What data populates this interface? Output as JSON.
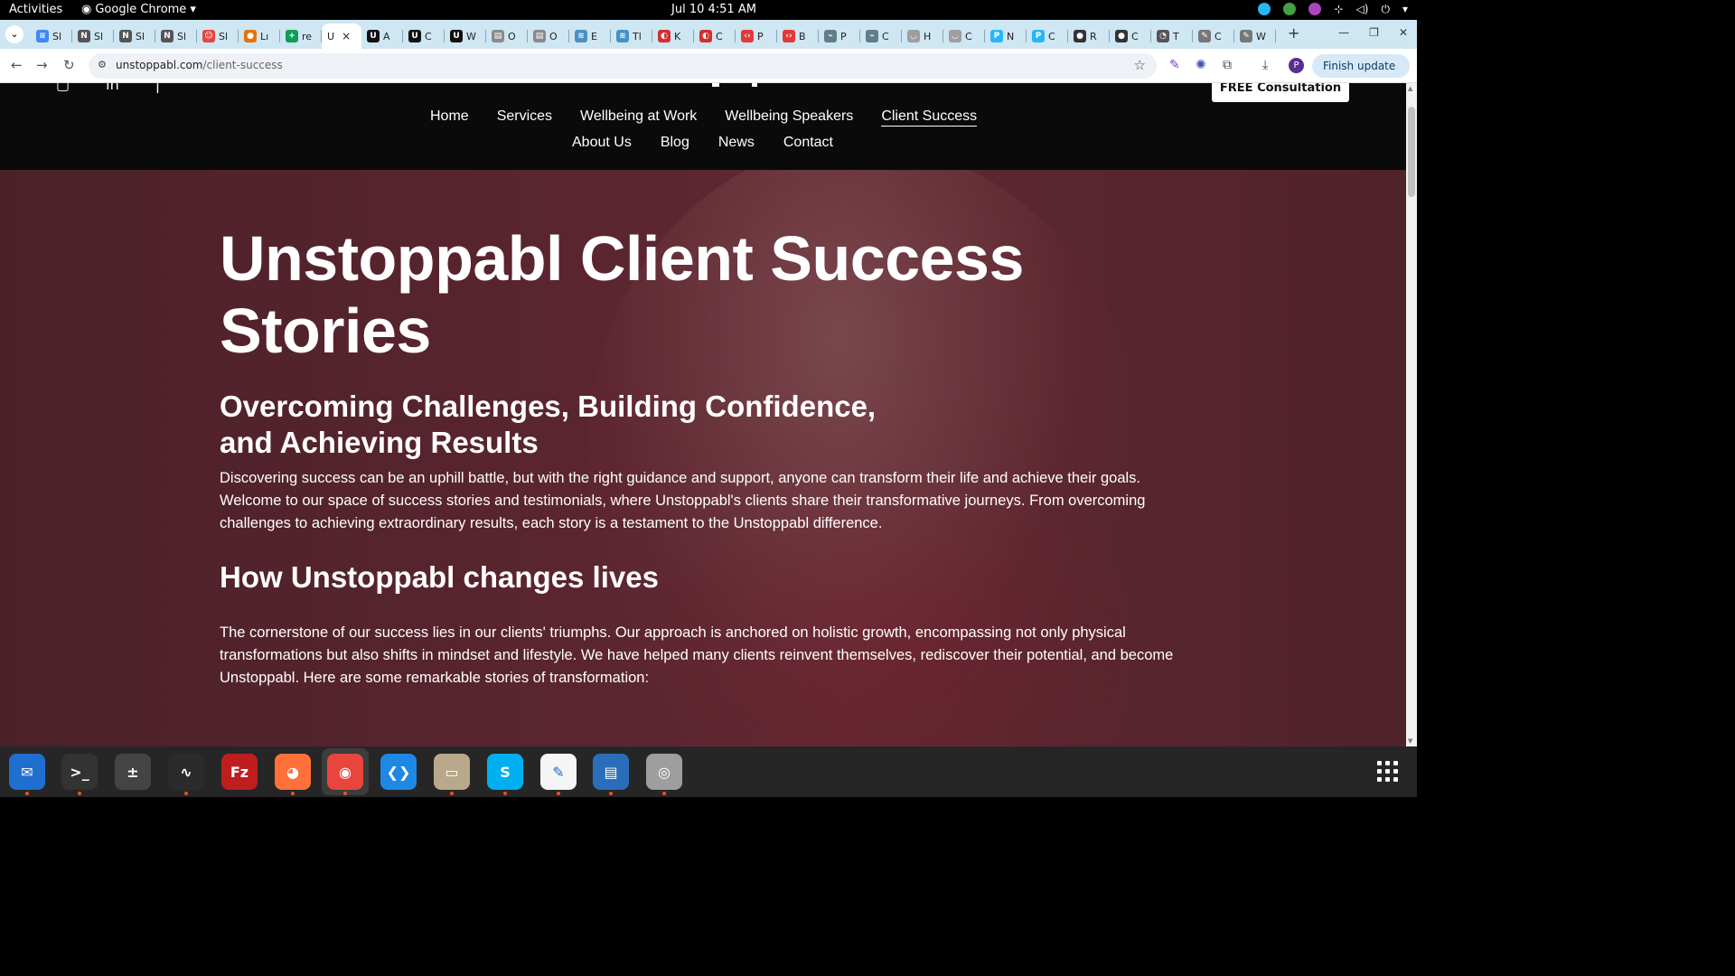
{
  "system": {
    "activities": "Activities",
    "app_name": "Google Chrome",
    "clock": "Jul 10  4:51 AM"
  },
  "browser": {
    "tabs": [
      {
        "label": "Sl",
        "color": "#4285f4",
        "glyph": "≡"
      },
      {
        "label": "Sl",
        "color": "#555555",
        "glyph": "N"
      },
      {
        "label": "Sl",
        "color": "#555555",
        "glyph": "N"
      },
      {
        "label": "Sl",
        "color": "#555555",
        "glyph": "N"
      },
      {
        "label": "Sl",
        "color": "#e8453c",
        "glyph": "☺"
      },
      {
        "label": "Lı",
        "color": "#e8710a",
        "glyph": "●"
      },
      {
        "label": "re",
        "color": "#0f9d58",
        "glyph": "+"
      },
      {
        "label": "U",
        "color": "#ffffff",
        "glyph": "",
        "active": true
      },
      {
        "label": "A",
        "color": "#111111",
        "glyph": "U"
      },
      {
        "label": "C",
        "color": "#111111",
        "glyph": "U"
      },
      {
        "label": "W",
        "color": "#111111",
        "glyph": "U"
      },
      {
        "label": "O",
        "color": "#8a8a8a",
        "glyph": "▤"
      },
      {
        "label": "O",
        "color": "#8a8a8a",
        "glyph": "▤"
      },
      {
        "label": "E",
        "color": "#4a90c2",
        "glyph": "≋"
      },
      {
        "label": "Tl",
        "color": "#4a90c2",
        "glyph": "≋"
      },
      {
        "label": "K",
        "color": "#d32f2f",
        "glyph": "◐"
      },
      {
        "label": "C",
        "color": "#d32f2f",
        "glyph": "◐"
      },
      {
        "label": "P",
        "color": "#e53935",
        "glyph": "‹›"
      },
      {
        "label": "B",
        "color": "#e53935",
        "glyph": "‹›"
      },
      {
        "label": "P",
        "color": "#607d8b",
        "glyph": "⌁"
      },
      {
        "label": "C",
        "color": "#607d8b",
        "glyph": "⌁"
      },
      {
        "label": "H",
        "color": "#9e9e9e",
        "glyph": "◡"
      },
      {
        "label": "C",
        "color": "#9e9e9e",
        "glyph": "◡"
      },
      {
        "label": "N",
        "color": "#29b6f6",
        "glyph": "P"
      },
      {
        "label": "C",
        "color": "#29b6f6",
        "glyph": "P"
      },
      {
        "label": "R",
        "color": "#333333",
        "glyph": "●"
      },
      {
        "label": "C",
        "color": "#333333",
        "glyph": "●"
      },
      {
        "label": "T",
        "color": "#555555",
        "glyph": "◔"
      },
      {
        "label": "C",
        "color": "#777777",
        "glyph": "✎"
      },
      {
        "label": "W",
        "color": "#777777",
        "glyph": "✎"
      }
    ],
    "active_tab_close": "×",
    "new_tab": "+",
    "url_host": "unstoppabl.com",
    "url_path": "/client-success",
    "finish_update": "Finish update",
    "profile_initial": "P"
  },
  "site": {
    "cta": "FREE Consultation",
    "nav_row1": [
      "Home",
      "Services",
      "Wellbeing at Work",
      "Wellbeing Speakers",
      "Client Success"
    ],
    "nav_row2": [
      "About Us",
      "Blog",
      "News",
      "Contact"
    ],
    "current_page": "Client Success",
    "hero_title": "Unstoppabl Client Success Stories",
    "subheading": "Overcoming Challenges, Building Confidence, and Achieving Results",
    "intro": "Discovering success can be an uphill battle, but with the right guidance and support, anyone can transform their life and achieve their goals. Welcome to our space of success stories and testimonials, where Unstoppabl's clients share their transformative journeys. From overcoming challenges to achieving extraordinary results, each story is a testament to the Unstoppabl difference.",
    "section_heading": "How Unstoppabl changes lives",
    "section_body": "The cornerstone of our success lies in our clients' triumphs. Our approach is anchored on holistic growth, encompassing not only physical transformations but also shifts in mindset and lifestyle. We have helped many clients reinvent themselves, rediscover their potential, and become Unstoppabl. Here are some remarkable stories of transformation:"
  },
  "colors": {
    "hero_bg": "#5a252f",
    "nav_bg": "#0a0a0a",
    "tabstrip_bg": "#cfe6f3"
  },
  "dock": [
    {
      "name": "thunderbird",
      "glyph": "✉",
      "bg": "#1f6fd1",
      "running": true
    },
    {
      "name": "terminal",
      "glyph": ">_",
      "bg": "#333333",
      "running": true
    },
    {
      "name": "calculator",
      "glyph": "±",
      "bg": "#444444",
      "running": false
    },
    {
      "name": "system-monitor",
      "glyph": "∿",
      "bg": "#2b2b2b",
      "running": true
    },
    {
      "name": "filezilla",
      "glyph": "Fz",
      "bg": "#bf1e1e",
      "running": false
    },
    {
      "name": "firefox",
      "glyph": "◕",
      "bg": "#ff7139",
      "running": true
    },
    {
      "name": "chrome",
      "glyph": "◉",
      "bg": "#e8453c",
      "running": true
    },
    {
      "name": "vscode",
      "glyph": "❮❯",
      "bg": "#1e88e5",
      "running": false
    },
    {
      "name": "files",
      "glyph": "▭",
      "bg": "#b8a98a",
      "running": true
    },
    {
      "name": "skype",
      "glyph": "S",
      "bg": "#00aff0",
      "running": true
    },
    {
      "name": "text-editor",
      "glyph": "✎",
      "bg": "#f5f5f5",
      "running": true
    },
    {
      "name": "writer",
      "glyph": "▤",
      "bg": "#2a6ebb",
      "running": true
    },
    {
      "name": "disks",
      "glyph": "◎",
      "bg": "#9e9e9e",
      "running": true
    }
  ]
}
